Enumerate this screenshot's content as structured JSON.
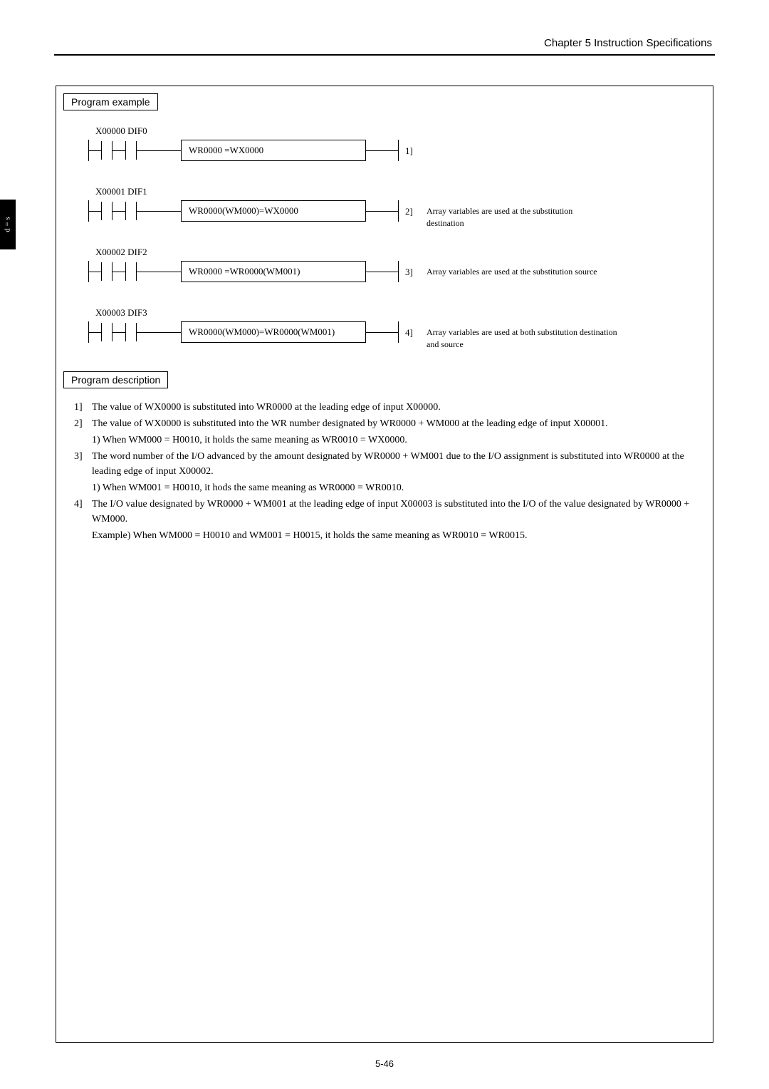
{
  "header": {
    "chapter": "Chapter 5  Instruction Specifications"
  },
  "side_tab": "d = s",
  "sections": {
    "example_label": "Program example",
    "desc_label": "Program description"
  },
  "rungs": [
    {
      "label": "X00000 DIF0",
      "inst": "WR0000          =WX0000",
      "num": "1]",
      "note": ""
    },
    {
      "label": "X00001 DIF1",
      "inst": "WR0000(WM000)=WX0000",
      "num": "2]",
      "note": "Array variables are used at the substitution destination"
    },
    {
      "label": "X00002 DIF2",
      "inst": "WR0000         =WR0000(WM001)",
      "num": "3]",
      "note": "Array variables are used at the substitution source"
    },
    {
      "label": "X00003 DIF3",
      "inst": "WR0000(WM000)=WR0000(WM001)",
      "num": "4]",
      "note": "Array variables are used at both substitution destination and source"
    }
  ],
  "description": [
    {
      "n": "1]",
      "t": "The value of WX0000 is substituted into WR0000 at the leading edge of input X00000."
    },
    {
      "n": "2]",
      "t": "The value of WX0000 is substituted into the WR number designated by WR0000 + WM000 at the leading edge of input X00001."
    },
    {
      "n": "",
      "t": "1)  When WM000 = H0010, it holds the same meaning as WR0010 = WX0000.",
      "sub": true
    },
    {
      "n": "3]",
      "t": "The word number of the I/O advanced by the amount designated by WR0000 + WM001 due to the I/O assignment is substituted into WR0000 at the leading edge of input X00002."
    },
    {
      "n": "",
      "t": "1)  When WM001 = H0010, it hods the same meaning as WR0000 = WR0010.",
      "sub": true
    },
    {
      "n": "4]",
      "t": "The I/O value designated by WR0000 + WM001 at the leading edge of input X00003 is substituted into the I/O of the value designated by WR0000 + WM000."
    },
    {
      "n": "",
      "t": "Example)  When WM000 = H0010 and WM001 = H0015, it holds the same meaning as WR0010 = WR0015.",
      "sub": true
    }
  ],
  "page_num": "5-46"
}
